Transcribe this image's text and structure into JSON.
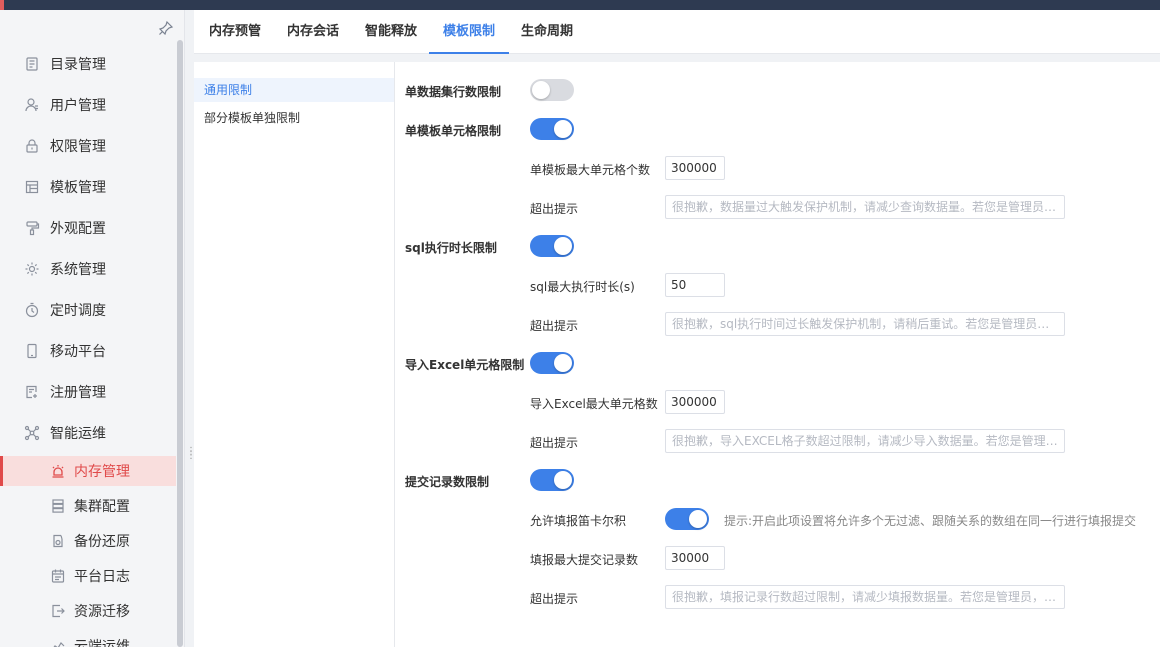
{
  "tabs": [
    {
      "label": "内存预管"
    },
    {
      "label": "内存会话"
    },
    {
      "label": "智能释放"
    },
    {
      "label": "模板限制",
      "active": true
    },
    {
      "label": "生命周期"
    }
  ],
  "sidebar": {
    "items": [
      {
        "label": "目录管理",
        "icon": "catalog-icon"
      },
      {
        "label": "用户管理",
        "icon": "user-icon"
      },
      {
        "label": "权限管理",
        "icon": "lock-icon"
      },
      {
        "label": "模板管理",
        "icon": "template-icon"
      },
      {
        "label": "外观配置",
        "icon": "paint-roller-icon"
      },
      {
        "label": "系统管理",
        "icon": "gear-icon"
      },
      {
        "label": "定时调度",
        "icon": "timer-icon"
      },
      {
        "label": "移动平台",
        "icon": "mobile-icon"
      },
      {
        "label": "注册管理",
        "icon": "register-icon"
      },
      {
        "label": "智能运维",
        "icon": "network-icon"
      }
    ],
    "sub_items": [
      {
        "label": "内存管理",
        "icon": "memory-icon",
        "active": true
      },
      {
        "label": "集群配置",
        "icon": "cluster-icon"
      },
      {
        "label": "备份还原",
        "icon": "backup-icon"
      },
      {
        "label": "平台日志",
        "icon": "log-icon"
      },
      {
        "label": "资源迁移",
        "icon": "migrate-icon"
      },
      {
        "label": "云端运维",
        "icon": "cloud-ops-icon"
      }
    ]
  },
  "left_menu": [
    {
      "label": "通用限制",
      "active": true
    },
    {
      "label": "部分模板单独限制"
    }
  ],
  "settings": {
    "dataset_rows": {
      "label": "单数据集行数限制",
      "enabled": false
    },
    "template_cells": {
      "label": "单模板单元格限制",
      "enabled": true,
      "max_label": "单模板最大单元格个数",
      "max_value": "300000",
      "tip_label": "超出提示",
      "tip_placeholder": "很抱歉，数据量过大触发保护机制，请减少查询数据量。若您是管理员，请前往内存管理中调整配置"
    },
    "sql_time": {
      "label": "sql执行时长限制",
      "enabled": true,
      "max_label": "sql最大执行时长(s)",
      "max_value": "50",
      "tip_label": "超出提示",
      "tip_placeholder": "很抱歉，sql执行时间过长触发保护机制，请稍后重试。若您是管理员，请前往内存管理中调整配置"
    },
    "excel_cells": {
      "label": "导入Excel单元格限制",
      "enabled": true,
      "max_label": "导入Excel最大单元格数",
      "max_value": "300000",
      "tip_label": "超出提示",
      "tip_placeholder": "很抱歉，导入EXCEL格子数超过限制，请减少导入数据量。若您是管理员，请前往内存管理中调整配置"
    },
    "submit_records": {
      "label": "提交记录数限制",
      "enabled": true,
      "cartesian_label": "允许填报笛卡尔积",
      "cartesian_enabled": true,
      "cartesian_hint": "提示:开启此项设置将允许多个无过滤、跟随关系的数组在同一行进行填报提交",
      "max_label": "填报最大提交记录数",
      "max_value": "30000",
      "tip_label": "超出提示",
      "tip_placeholder": "很抱歉，填报记录行数超过限制，请减少填报数据量。若您是管理员，请前往内存管理中调整配置"
    }
  },
  "colors": {
    "accent": "#3d80e8",
    "active_red": "#e04a4a",
    "topbar": "#2e3a51"
  }
}
